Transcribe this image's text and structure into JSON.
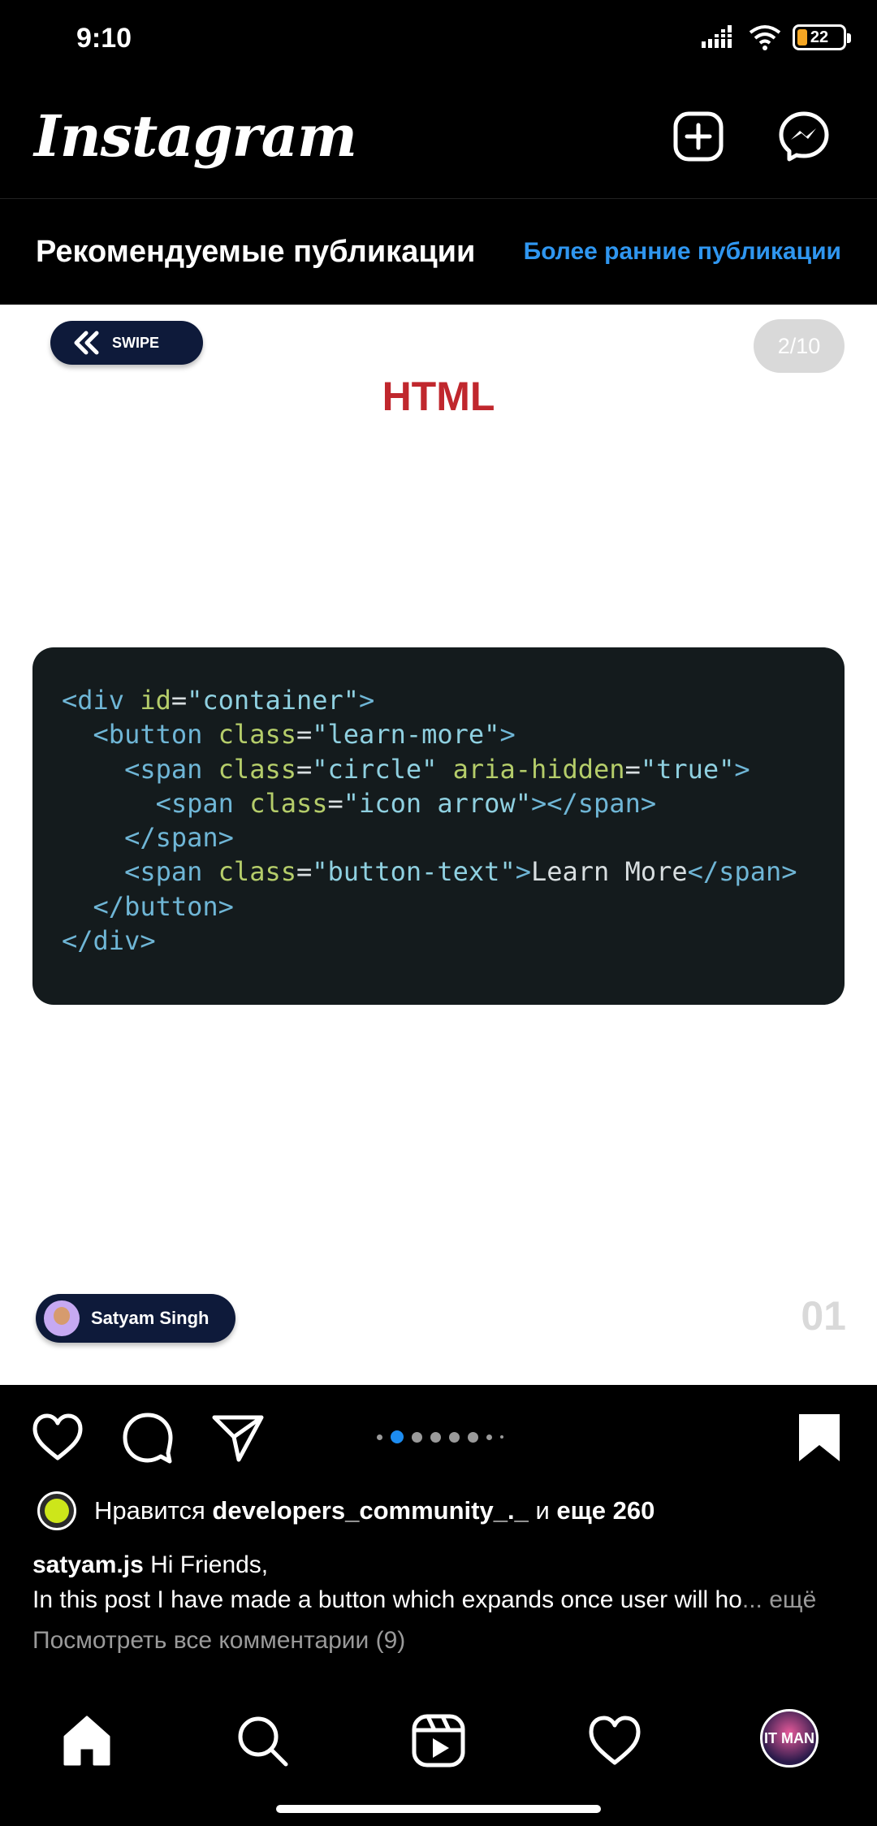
{
  "status_bar": {
    "time": "9:10",
    "battery_level": "22"
  },
  "header": {
    "logo": "Instagram"
  },
  "feed": {
    "title": "Рекомендуемые публикации",
    "older_link": "Более ранние публикации"
  },
  "post": {
    "swipe_label": "SWIPE",
    "counter": "2/10",
    "slide_title": "HTML",
    "author_name": "Satyam Singh",
    "slide_number": "01",
    "code": {
      "line1_tag1": "<div",
      "line1_attr": "id",
      "line1_eq": "=",
      "line1_val": "\"container\"",
      "line1_close": ">",
      "line2_tag": "<button",
      "line2_attr": "class",
      "line2_eq": "=",
      "line2_val": "\"learn-more\"",
      "line2_close": ">",
      "line3_tag": "<span",
      "line3_attr1": "class",
      "line3_eq1": "=",
      "line3_val1": "\"circle\"",
      "line3_attr2": "aria-hidden",
      "line3_eq2": "=",
      "line3_val2": "\"true\"",
      "line3_close": ">",
      "line4_tag": "<span",
      "line4_attr": "class",
      "line4_eq": "=",
      "line4_val": "\"icon arrow\"",
      "line4_close": "></span>",
      "line5": "</span>",
      "line6_tag": "<span",
      "line6_attr": "class",
      "line6_eq": "=",
      "line6_val": "\"button-text\"",
      "line6_gt": ">",
      "line6_text": "Learn More",
      "line6_close": "</span>",
      "line7": "</button>",
      "line8": "</div>"
    },
    "carousel": {
      "count": 8,
      "active_index": 1
    },
    "likes": {
      "prefix": "Нравится",
      "user": "developers_community_._",
      "conj": "и",
      "others": "еще 260"
    },
    "caption": {
      "username": "satyam.js",
      "line1": "Hi Friends,",
      "line2": "In this post I have made a button which expands once user will ho",
      "ellipsis": "...",
      "more": "ещё"
    },
    "comments_link": "Посмотреть все комментарии (9)"
  },
  "profile": {
    "initials": "IT MAN"
  },
  "colors": {
    "accent_blue": "#1d8cf0",
    "title_red": "#c0272d",
    "badge_navy": "#0e1a3a",
    "code_bg": "#141b1d"
  },
  "icons": {
    "create": "plus-square-icon",
    "messenger": "messenger-icon",
    "like": "heart-icon",
    "comment": "comment-icon",
    "share": "send-icon",
    "save": "bookmark-icon",
    "home": "home-icon",
    "search": "search-icon",
    "reels": "reels-icon",
    "activity": "heart-icon"
  }
}
